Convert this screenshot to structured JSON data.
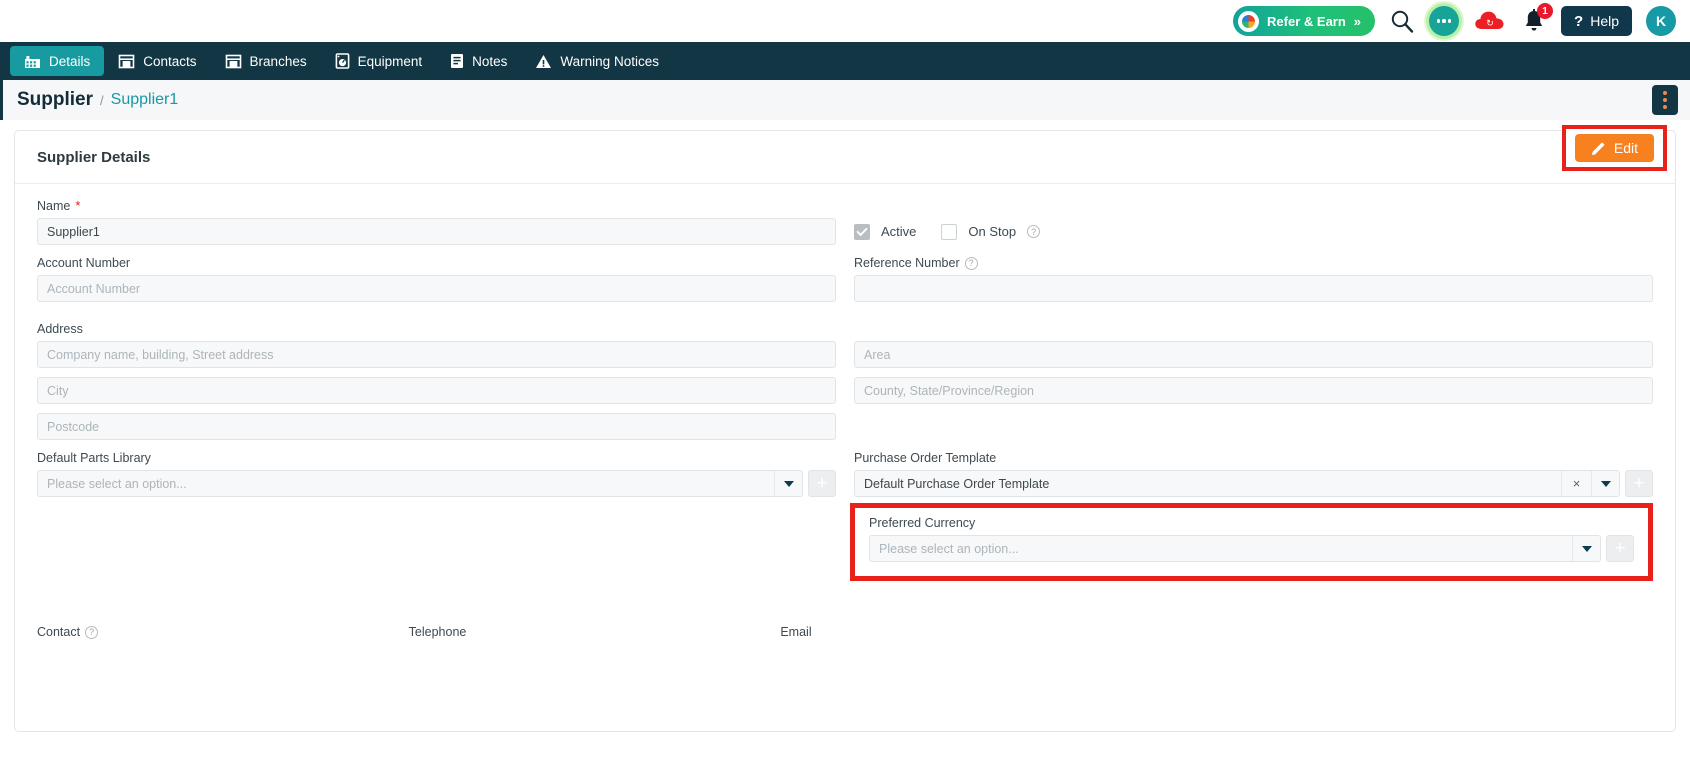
{
  "topbar": {
    "refer_label": "Refer & Earn",
    "refer_chevron": "»",
    "search_icon": "search-icon",
    "chat_icon": "chat-bubble-icon",
    "sync_icon": "cloud-sync-icon",
    "bell_icon": "notification-bell-icon",
    "notification_count": "1",
    "help_label": "Help",
    "help_mark": "?",
    "avatar_initial": "K"
  },
  "nav": {
    "tabs": [
      {
        "label": "Details",
        "icon": "factory-icon",
        "active": true
      },
      {
        "label": "Contacts",
        "icon": "store-icon",
        "active": false
      },
      {
        "label": "Branches",
        "icon": "store-icon",
        "active": false
      },
      {
        "label": "Equipment",
        "icon": "washing-machine-icon",
        "active": false
      },
      {
        "label": "Notes",
        "icon": "document-lines-icon",
        "active": false
      },
      {
        "label": "Warning Notices",
        "icon": "warning-triangle-icon",
        "active": false
      }
    ]
  },
  "breadcrumb": {
    "main": "Supplier",
    "separator": "/",
    "sub": "Supplier1"
  },
  "card": {
    "title": "Supplier Details",
    "edit_label": "Edit"
  },
  "form": {
    "name": {
      "label": "Name",
      "required_mark": "*",
      "value": "Supplier1"
    },
    "account_number": {
      "label": "Account Number",
      "placeholder": "Account Number",
      "value": ""
    },
    "active": {
      "label": "Active",
      "checked": true
    },
    "on_stop": {
      "label": "On Stop",
      "checked": false,
      "help": "?"
    },
    "reference_number": {
      "label": "Reference Number",
      "help": "?",
      "value": ""
    },
    "address": {
      "label": "Address",
      "street_placeholder": "Company name, building, Street address",
      "city_placeholder": "City",
      "postcode_placeholder": "Postcode",
      "area_placeholder": "Area",
      "county_placeholder": "County, State/Province/Region"
    },
    "default_parts_library": {
      "label": "Default Parts Library",
      "placeholder": "Please select an option..."
    },
    "purchase_order_template": {
      "label": "Purchase Order Template",
      "value": "Default Purchase Order Template",
      "clear_glyph": "×"
    },
    "preferred_currency": {
      "label": "Preferred Currency",
      "placeholder": "Please select an option..."
    },
    "contact": {
      "label": "Contact",
      "help": "?"
    },
    "telephone": {
      "label": "Telephone"
    },
    "email": {
      "label": "Email"
    }
  },
  "colors": {
    "nav_bg": "#123644",
    "tab_active": "#179ba0",
    "edit_orange": "#f7811e",
    "highlight_red": "#e8211b",
    "link_teal": "#1799a6",
    "badge_red": "#e8192c"
  }
}
